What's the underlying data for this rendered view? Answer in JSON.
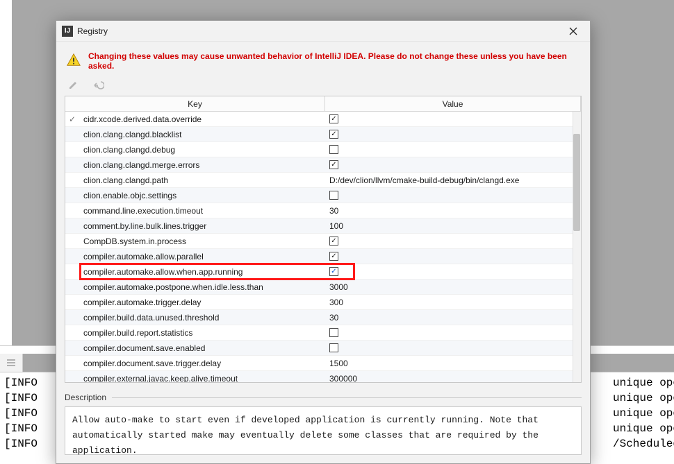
{
  "window": {
    "title": "Registry",
    "warning": "Changing these values may cause unwanted behavior of IntelliJ IDEA. Please do not change these unless you have been asked."
  },
  "table": {
    "headers": {
      "key": "Key",
      "value": "Value"
    },
    "rows": [
      {
        "modified": true,
        "key": "cidr.xcode.derived.data.override",
        "type": "check",
        "checked": true
      },
      {
        "modified": false,
        "key": "clion.clang.clangd.blacklist",
        "type": "check",
        "checked": true
      },
      {
        "modified": false,
        "key": "clion.clang.clangd.debug",
        "type": "check",
        "checked": false
      },
      {
        "modified": false,
        "key": "clion.clang.clangd.merge.errors",
        "type": "check",
        "checked": true
      },
      {
        "modified": false,
        "key": "clion.clang.clangd.path",
        "type": "text",
        "value": "D:/dev/clion/llvm/cmake-build-debug/bin/clangd.exe"
      },
      {
        "modified": false,
        "key": "clion.enable.objc.settings",
        "type": "check",
        "checked": false
      },
      {
        "modified": false,
        "key": "command.line.execution.timeout",
        "type": "text",
        "value": "30"
      },
      {
        "modified": false,
        "key": "comment.by.line.bulk.lines.trigger",
        "type": "text",
        "value": "100"
      },
      {
        "modified": false,
        "key": "CompDB.system.in.process",
        "type": "check",
        "checked": true
      },
      {
        "modified": false,
        "key": "compiler.automake.allow.parallel",
        "type": "check",
        "checked": true
      },
      {
        "modified": false,
        "key": "compiler.automake.allow.when.app.running",
        "type": "check",
        "checked": true,
        "highlighted": true,
        "blue": true
      },
      {
        "modified": false,
        "key": "compiler.automake.postpone.when.idle.less.than",
        "type": "text",
        "value": "3000"
      },
      {
        "modified": false,
        "key": "compiler.automake.trigger.delay",
        "type": "text",
        "value": "300"
      },
      {
        "modified": false,
        "key": "compiler.build.data.unused.threshold",
        "type": "text",
        "value": "30"
      },
      {
        "modified": false,
        "key": "compiler.build.report.statistics",
        "type": "check",
        "checked": false
      },
      {
        "modified": false,
        "key": "compiler.document.save.enabled",
        "type": "check",
        "checked": false
      },
      {
        "modified": false,
        "key": "compiler.document.save.trigger.delay",
        "type": "text",
        "value": "1500"
      },
      {
        "modified": false,
        "key": "compiler.external.javac.keep.alive.timeout",
        "type": "text",
        "value": "300000"
      }
    ]
  },
  "description": {
    "label": "Description",
    "text": "Allow auto-make to start even if developed application is currently running. Note that automatically started make may eventually delete some classes that are required by the application."
  },
  "console": {
    "left": "[INFO",
    "right_fragments": [
      "unique ope",
      "unique ope",
      "unique ope",
      "unique ope",
      "/Scheduled"
    ]
  }
}
